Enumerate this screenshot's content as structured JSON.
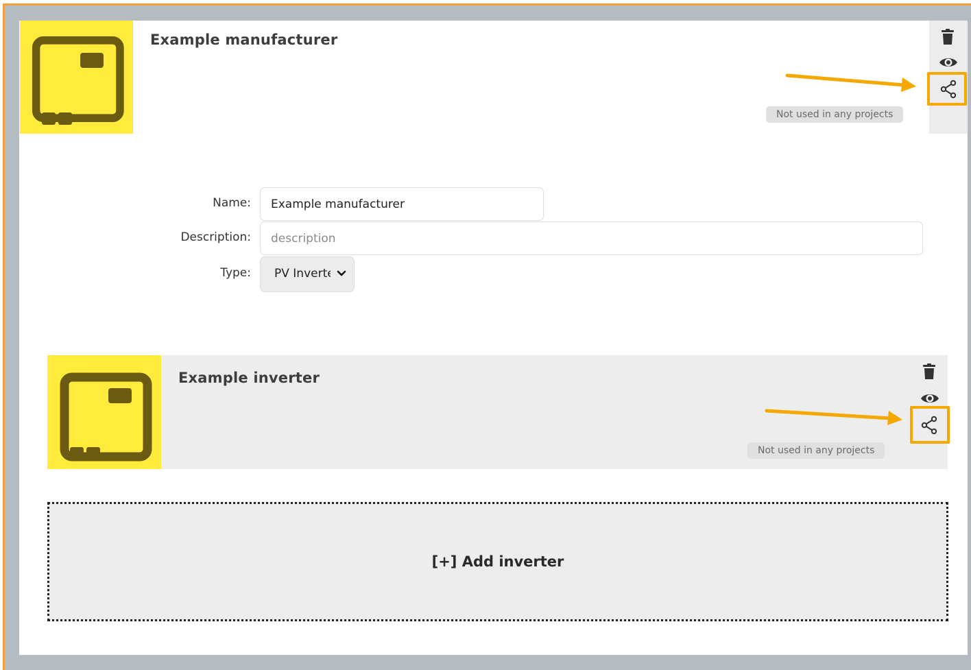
{
  "manufacturer": {
    "title": "Example manufacturer",
    "usage_badge": "Not used in any projects",
    "icons": {
      "delete": "trash-icon",
      "view": "eye-icon",
      "share": "share-icon"
    },
    "thumbnail_icon": "inverter-device-icon"
  },
  "form": {
    "name_label": "Name:",
    "name_value": "Example manufacturer",
    "description_label": "Description:",
    "description_placeholder": "description",
    "type_label": "Type:",
    "type_value": "PV Inverter"
  },
  "inverter": {
    "title": "Example inverter",
    "usage_badge": "Not used in any projects",
    "icons": {
      "delete": "trash-icon",
      "view": "eye-icon",
      "share": "share-icon"
    },
    "thumbnail_icon": "inverter-device-icon"
  },
  "add_inverter": {
    "label": "[+] Add inverter"
  },
  "colors": {
    "accent_annotation": "#f5a800",
    "thumbnail_background": "#ffeb3b",
    "thumbnail_icon": "#6b5a12",
    "frame_border": "#f5a03c"
  }
}
